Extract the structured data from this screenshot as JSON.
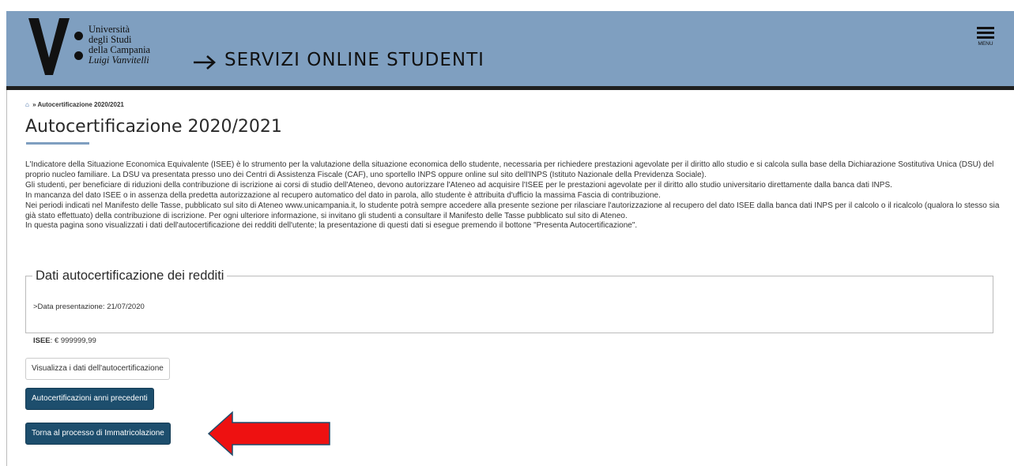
{
  "header": {
    "logo_line1": "Università",
    "logo_line2": "degli Studi",
    "logo_line3": "della Campania",
    "logo_line4": "Luigi Vanvitelli",
    "site_title": "SERVIZI ONLINE STUDENTI",
    "menu_label": "MENU",
    "bg_color": "#7f9fc0"
  },
  "breadcrumb": {
    "separator": "»",
    "current": "Autocertificazione 2020/2021"
  },
  "page_title": "Autocertificazione 2020/2021",
  "intro": [
    "L'Indicatore della Situazione Economica Equivalente (ISEE) è lo strumento per la valutazione della situazione economica dello studente, necessaria per richiedere prestazioni agevolate per il diritto allo studio e si calcola sulla base della Dichiarazione Sostitutiva Unica (DSU) del proprio nucleo familiare. La DSU va presentata presso uno dei Centri di Assistenza Fiscale (CAF), uno sportello INPS oppure online sul sito dell'INPS (Istituto Nazionale della Previdenza Sociale).",
    "Gli studenti, per beneficiare di riduzioni della contribuzione di iscrizione ai corsi di studio dell'Ateneo, devono autorizzare l'Ateneo ad acquisire l'ISEE per le prestazioni agevolate per il diritto allo studio universitario direttamente dalla banca dati INPS.",
    "In mancanza del dato ISEE o in assenza della predetta autorizzazione al recupero automatico del dato in parola, allo studente è attribuita d'ufficio la massima Fascia di contribuzione.",
    "Nei periodi indicati nel Manifesto delle Tasse, pubblicato sul sito di Ateneo www.unicampania.it, lo studente potrà sempre accedere alla presente sezione per rilasciare l'autorizzazione al recupero del dato ISEE dalla banca dati INPS per il calcolo o il ricalcolo (qualora lo stesso sia già stato effettuato) della contribuzione di iscrizione. Per ogni ulteriore informazione, si invitano gli studenti a consultare il Manifesto delle Tasse pubblicato sul sito di Ateneo.",
    "In questa pagina sono visualizzati i dati dell'autocertificazione dei redditi dell'utente; la presentazione di questi dati si esegue premendo il bottone \"Presenta Autocertificazione\"."
  ],
  "box": {
    "legend": "Dati autocertificazione dei redditi",
    "date_line": ">Data presentazione: 21/07/2020",
    "isee_label": "ISEE",
    "isee_value": ": € 999999,99"
  },
  "buttons": {
    "view_data": "Visualizza i dati dell'autocertificazione",
    "previous_years": "Autocertificazioni anni precedenti",
    "back_to_enrollment": "Torna al processo di Immatricolazione"
  },
  "colors": {
    "primary_button": "#1d4e6d",
    "annotation_arrow": "#ee1111"
  }
}
